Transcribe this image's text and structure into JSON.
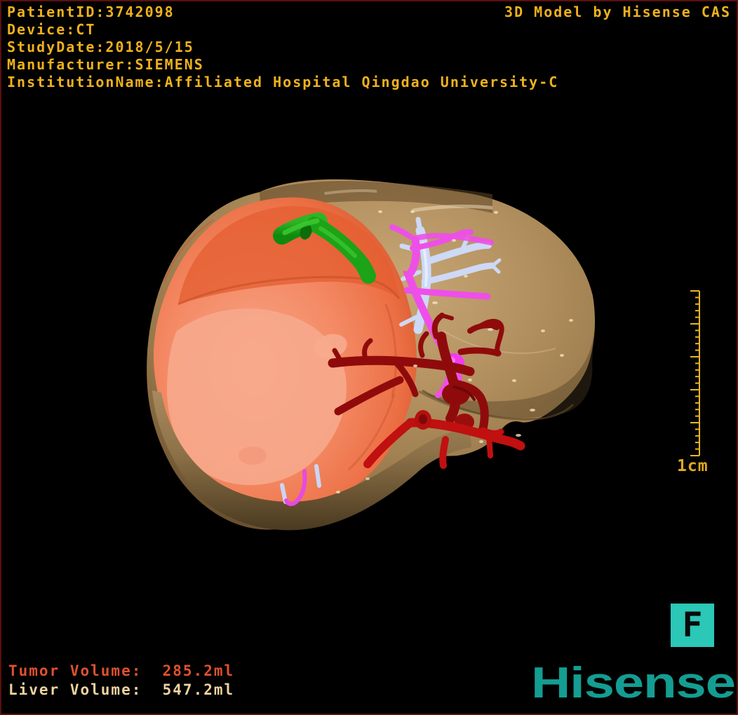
{
  "header": {
    "metadata_lines": [
      "PatientID:3742098",
      "Device:CT",
      "StudyDate:2018/5/15",
      "Manufacturer:SIEMENS",
      "InstitutionName:Affiliated Hospital Qingdao University-C"
    ],
    "watermark": "3D Model by Hisense CAS"
  },
  "scale_bar": {
    "label": "1cm",
    "major_divisions": 5
  },
  "orientation_marker": {
    "letter": "F"
  },
  "footer": {
    "measurements": [
      {
        "name": "tumor-volume",
        "label": "Tumor Volume: ",
        "value": " 285.2ml"
      },
      {
        "name": "liver-volume",
        "label": "Liver Volume: ",
        "value": " 547.2ml"
      }
    ],
    "logo_text": "Hisense"
  },
  "model": {
    "structures": [
      {
        "name": "liver",
        "color": "#b3905f"
      },
      {
        "name": "tumor",
        "color": "#f48b66"
      },
      {
        "name": "bile-duct",
        "color": "#1ca318"
      },
      {
        "name": "hepatic-vein",
        "color": "#cdd9f6"
      },
      {
        "name": "portal-vein",
        "color": "#ee4fe8"
      },
      {
        "name": "artery-dark",
        "color": "#8f0b0b"
      },
      {
        "name": "artery-bright",
        "color": "#c01010"
      }
    ]
  },
  "colors": {
    "overlay_text": "#efb11d",
    "tumor_text": "#e0512e",
    "liver_text": "#eed3a0",
    "marker_teal": "#2bc7b7",
    "logo_teal": "#149d92",
    "frame_border": "#5a1010",
    "background": "#000000",
    "ruler_gold": "#e9b625"
  }
}
